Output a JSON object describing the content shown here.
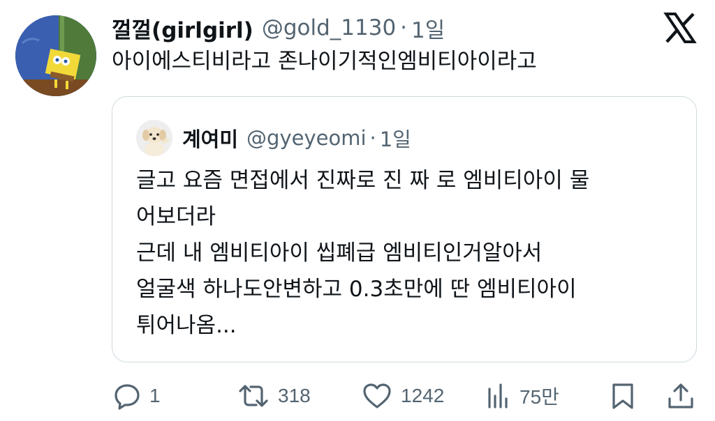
{
  "tweet": {
    "author_name": "껄껄(girlgirl)",
    "author_handle": "@gold_1130",
    "separator": "·",
    "time": "1일",
    "text": "아이에스티비라고 존나이기적인엠비티아이라고",
    "avatar_icon": "spongebob-avatar"
  },
  "quoted": {
    "author_name": "계여미",
    "author_handle": "@gyeyeomi",
    "separator": "·",
    "time": "1일",
    "avatar_icon": "puppy-avatar",
    "lines": [
      "글고 요즘 면접에서 진짜로 진 짜 로 엠비티아이 물",
      "어보더라",
      "근데 내 엠비티아이 씹폐급 엠비티인거알아서",
      "얼굴색 하나도안변하고 0.3초만에 딴 엠비티아이",
      "튀어나옴..."
    ]
  },
  "actions": {
    "reply_count": "1",
    "retweet_count": "318",
    "like_count": "1242",
    "view_count": "75만"
  },
  "icons": {
    "reply": "reply-icon",
    "retweet": "retweet-icon",
    "like": "heart-icon",
    "views": "views-icon",
    "bookmark": "bookmark-icon",
    "share": "share-icon",
    "brand": "x-logo-icon"
  },
  "colors": {
    "text": "#0f1419",
    "secondary": "#536471",
    "border": "#cfd9de"
  }
}
